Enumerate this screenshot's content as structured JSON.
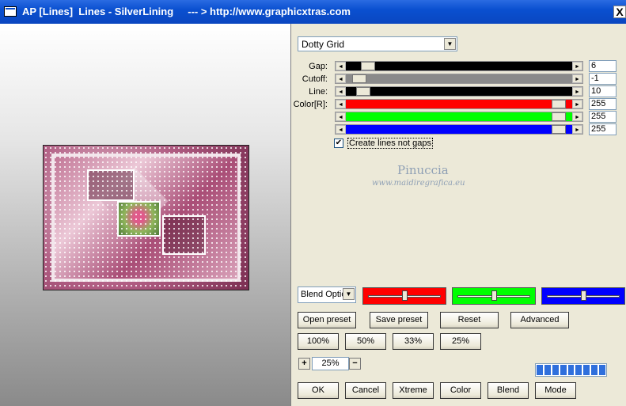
{
  "window": {
    "title": "AP [Lines]  Lines - SilverLining     --- > http://www.graphicxtras.com",
    "close_label": "X"
  },
  "preset": {
    "selected": "Dotty Grid"
  },
  "sliders": [
    {
      "label": "Gap:",
      "value": "6",
      "track_color": "#000000",
      "fill": 0.07
    },
    {
      "label": "Cutoff:",
      "value": "-1",
      "track_color": "#8a8a8a",
      "fill": 0.03
    },
    {
      "label": "Line:",
      "value": "10",
      "track_color": "#000000",
      "fill": 0.05
    },
    {
      "label": "Color[R]:",
      "value": "255",
      "track_color": "#ff0000",
      "fill": 0.97
    },
    {
      "label": "",
      "value": "255",
      "track_color": "#00ff00",
      "fill": 0.97
    },
    {
      "label": "",
      "value": "255",
      "track_color": "#0000ff",
      "fill": 0.97
    }
  ],
  "checkbox": {
    "label": "Create lines not gaps",
    "checked": true
  },
  "watermark": {
    "line1": "Pinuccia",
    "line2": "www.maidiregrafica.eu"
  },
  "blend": {
    "selected": "Blend Options"
  },
  "color_boxes": [
    {
      "color": "#ff0000",
      "level": 0.5
    },
    {
      "color": "#00ff00",
      "level": 0.5
    },
    {
      "color": "#0000ff",
      "level": 0.5
    }
  ],
  "buttons": {
    "open_preset": "Open preset",
    "save_preset": "Save preset",
    "reset": "Reset",
    "advanced": "Advanced",
    "z100": "100%",
    "z50": "50%",
    "z33": "33%",
    "z25": "25%",
    "ok": "OK",
    "cancel": "Cancel",
    "xtreme": "Xtreme",
    "color": "Color",
    "blend": "Blend",
    "mode": "Mode"
  },
  "zoom": {
    "plus": "+",
    "minus": "−",
    "value": "25%"
  },
  "progress": {
    "blocks": 9
  }
}
